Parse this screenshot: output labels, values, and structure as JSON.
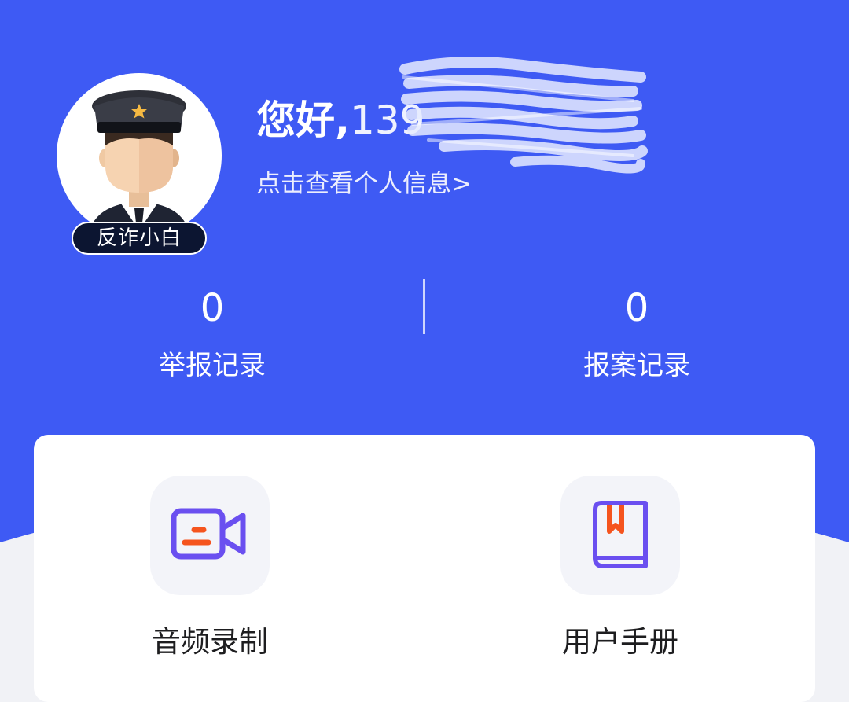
{
  "profile": {
    "greeting": "您好,",
    "phone_visible": "139",
    "view_profile_link": "点击查看个人信息>",
    "role_badge": "反诈小白",
    "avatar_icon": "police-officer-avatar"
  },
  "stats": [
    {
      "count": "0",
      "label": "举报记录"
    },
    {
      "count": "0",
      "label": "报案记录"
    }
  ],
  "tools": [
    {
      "label": "音频录制",
      "icon": "video-camera-icon"
    },
    {
      "label": "用户手册",
      "icon": "book-icon"
    }
  ],
  "colors": {
    "header_blue": "#3e5af4",
    "page_background": "#f1f2f6",
    "icon_purple": "#6a4ff0",
    "icon_orange": "#f5541e",
    "badge_navy": "#0c1531"
  }
}
